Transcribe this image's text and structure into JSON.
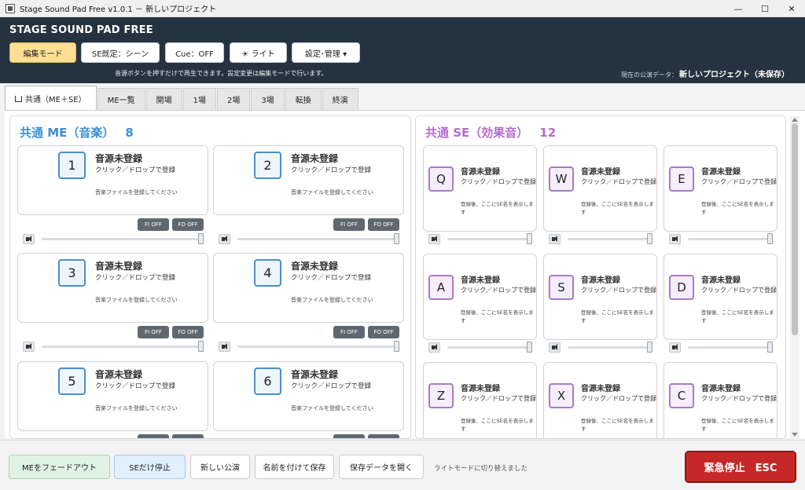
{
  "window": {
    "title": "Stage Sound Pad Free v1.0.1 － 新しいプロジェクト",
    "minimize_glyph": "—",
    "maximize_glyph": "☐",
    "close_glyph": "✕"
  },
  "header": {
    "app_name": "STAGE SOUND PAD FREE",
    "buttons": {
      "edit_mode": "編集モード",
      "se_default": "SE既定：シーン",
      "cue": "Cue：OFF",
      "light": "☀ ライト",
      "settings": "設定･管理 ▾"
    },
    "hint": "音源ボタンを押すだけで再生できます。設定変更は編集モードで行います。",
    "project_label": "現在の公演データ：",
    "project_name": "新しいプロジェクト（未保存）"
  },
  "tabs": [
    "共通（ME＋SE）",
    "ME一覧",
    "開場",
    "1場",
    "2場",
    "3場",
    "転換",
    "終演"
  ],
  "me_panel": {
    "title": "共通 ME（音楽）",
    "count": "8",
    "cards": [
      {
        "key": "1",
        "title": "音源未登録",
        "sub": "クリック／ドロップで登録",
        "hint": "音楽ファイルを登録してください",
        "fi": "FI OFF",
        "fo": "FO OFF"
      },
      {
        "key": "2",
        "title": "音源未登録",
        "sub": "クリック／ドロップで登録",
        "hint": "音楽ファイルを登録してください",
        "fi": "FI OFF",
        "fo": "FO OFF"
      },
      {
        "key": "3",
        "title": "音源未登録",
        "sub": "クリック／ドロップで登録",
        "hint": "音楽ファイルを登録してください",
        "fi": "FI OFF",
        "fo": "FO OFF"
      },
      {
        "key": "4",
        "title": "音源未登録",
        "sub": "クリック／ドロップで登録",
        "hint": "音楽ファイルを登録してください",
        "fi": "FI OFF",
        "fo": "FO OFF"
      },
      {
        "key": "5",
        "title": "音源未登録",
        "sub": "クリック／ドロップで登録",
        "hint": "音楽ファイルを登録してください"
      },
      {
        "key": "6",
        "title": "音源未登録",
        "sub": "クリック／ドロップで登録",
        "hint": "音楽ファイルを登録してください"
      }
    ]
  },
  "se_panel": {
    "title": "共通 SE（効果音）",
    "count": "12",
    "cards": [
      {
        "key": "Q",
        "title": "音源未登録",
        "sub": "クリック／ドロップで登録",
        "hint": "登録後、ここにSE名を表示します"
      },
      {
        "key": "W",
        "title": "音源未登録",
        "sub": "クリック／ドロップで登録",
        "hint": "登録後、ここにSE名を表示します"
      },
      {
        "key": "E",
        "title": "音源未登録",
        "sub": "クリック／ドロップで登録",
        "hint": "登録後、ここにSE名を表示します"
      },
      {
        "key": "A",
        "title": "音源未登録",
        "sub": "クリック／ドロップで登録",
        "hint": "登録後、ここにSE名を表示します"
      },
      {
        "key": "S",
        "title": "音源未登録",
        "sub": "クリック／ドロップで登録",
        "hint": "登録後、ここにSE名を表示します"
      },
      {
        "key": "D",
        "title": "音源未登録",
        "sub": "クリック／ドロップで登録",
        "hint": "登録後、ここにSE名を表示します"
      },
      {
        "key": "Z",
        "title": "音源未登録",
        "sub": "クリック／ドロップで登録",
        "hint": "登録後、ここにSE名を表示します"
      },
      {
        "key": "X",
        "title": "音源未登録",
        "sub": "クリック／ドロップで登録",
        "hint": "登録後、ここにSE名を表示します"
      },
      {
        "key": "C",
        "title": "音源未登録",
        "sub": "クリック／ドロップで登録",
        "hint": "登録後、ここにSE名を表示します"
      }
    ]
  },
  "volume": {
    "level": 1.0
  },
  "footer": {
    "fade_out_me": "MEをフェードアウト",
    "stop_se": "SEだけ停止",
    "new_show": "新しい公演",
    "save_as": "名前を付けて保存",
    "open_data": "保存データを開く",
    "status": "ライトモードに切り替えました",
    "emergency_stop": "緊急停止　ESC"
  },
  "colors": {
    "header_bg": "#253240",
    "edit_mode_active": "#ffdf95",
    "me_accent": "#3d8fd8",
    "se_accent": "#b56bd2",
    "emergency": "#c62828"
  }
}
